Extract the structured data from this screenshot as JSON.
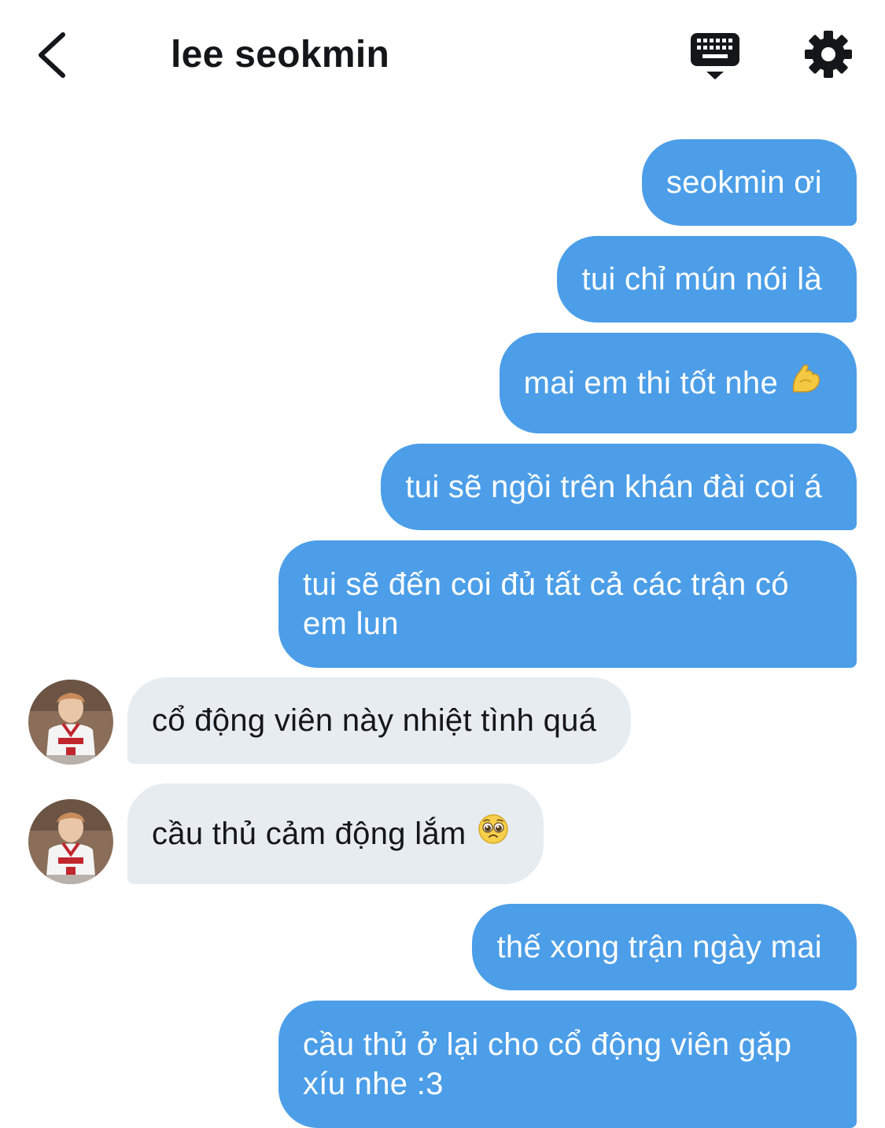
{
  "header": {
    "title": "lee seokmin"
  },
  "icons": {
    "back": "chevron-left-icon",
    "keyboard": "keyboard-icon",
    "settings": "gear-icon"
  },
  "messages": [
    {
      "side": "out",
      "text": "seokmin ơi"
    },
    {
      "side": "out",
      "text": "tui chỉ mún nói là"
    },
    {
      "side": "out",
      "text": "mai em thi tốt nhe",
      "emoji": "flexed-biceps-emoji"
    },
    {
      "side": "out",
      "text": "tui sẽ ngồi trên khán đài coi á"
    },
    {
      "side": "out",
      "text": "tui sẽ đến coi đủ tất cả các trận có em lun"
    },
    {
      "side": "in",
      "text": "cổ động viên này nhiệt tình quá"
    },
    {
      "side": "in",
      "text": "cầu thủ cảm động lắm",
      "emoji": "pleading-face-emoji"
    },
    {
      "side": "out",
      "text": "thế xong trận ngày mai"
    },
    {
      "side": "out",
      "text": "cầu thủ ở lại cho cổ động viên gặp xíu nhe :3"
    }
  ],
  "colors": {
    "outgoing_bubble": "#4c9ee8",
    "incoming_bubble": "#e6ecf0",
    "outgoing_text": "#ffffff",
    "incoming_text": "#14171a"
  }
}
